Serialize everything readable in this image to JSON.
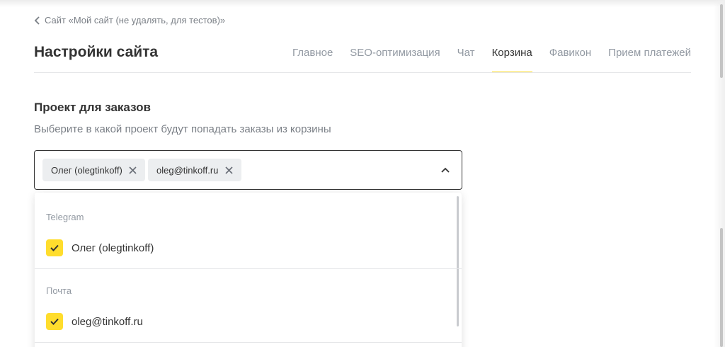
{
  "breadcrumb": {
    "label": "Сайт «Мой сайт (не удалять, для тестов)»"
  },
  "page": {
    "title": "Настройки сайта"
  },
  "tabs": [
    {
      "label": "Главное",
      "active": false
    },
    {
      "label": "SEO-оптимизация",
      "active": false
    },
    {
      "label": "Чат",
      "active": false
    },
    {
      "label": "Корзина",
      "active": true
    },
    {
      "label": "Фавикон",
      "active": false
    },
    {
      "label": "Прием платежей",
      "active": false
    }
  ],
  "section": {
    "title": "Проект для заказов",
    "description": "Выберите в какой проект будут попадать заказы из корзины"
  },
  "multiselect": {
    "chips": [
      {
        "label": "Олег (olegtinkoff)"
      },
      {
        "label": "oleg@tinkoff.ru"
      }
    ],
    "expanded": true
  },
  "dropdown": {
    "groups": [
      {
        "label": "Telegram",
        "option": {
          "label": "Олег (olegtinkoff)",
          "checked": true
        }
      },
      {
        "label": "Почта",
        "option": {
          "label": "oleg@tinkoff.ru",
          "checked": true
        }
      }
    ]
  },
  "colors": {
    "accent": "#ffdd2d",
    "text": "#333333",
    "muted": "#9299a2",
    "chip_bg": "#eceef0"
  },
  "icons": [
    "chevron-left-icon",
    "close-icon",
    "chevron-up-icon",
    "check-icon"
  ]
}
